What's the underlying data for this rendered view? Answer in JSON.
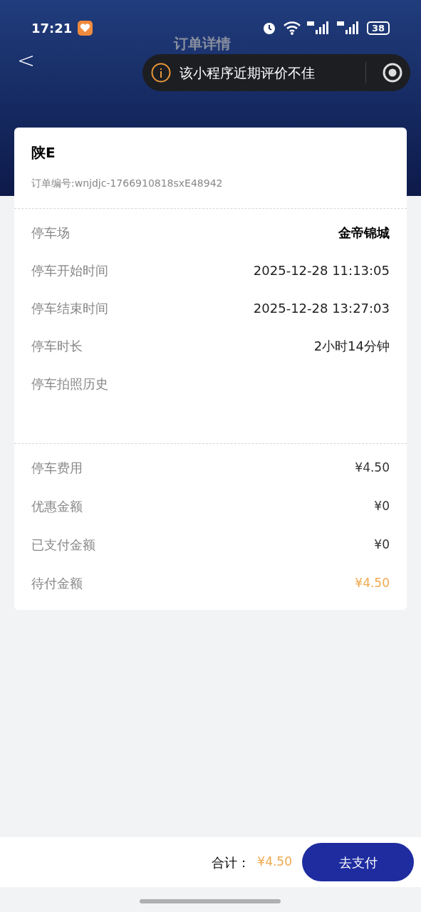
{
  "status_bar": {
    "time": "17:21",
    "battery": "38"
  },
  "nav": {
    "back": "<",
    "title": "订单详情"
  },
  "toast": {
    "text": "该小程序近期评价不佳"
  },
  "order": {
    "plate": "陕E",
    "order_no": "订单编号:wnjdjc-1766910818sxE48942"
  },
  "details": [
    {
      "label": "停车场",
      "value": "金帝锦城",
      "bold": true
    },
    {
      "label": "停车开始时间",
      "value": "2025-12-28 11:13:05",
      "bold": false
    },
    {
      "label": "停车结束时间",
      "value": "2025-12-28 13:27:03",
      "bold": false
    },
    {
      "label": "停车时长",
      "value": "2小时14分钟",
      "bold": false
    },
    {
      "label": "停车拍照历史"
    }
  ],
  "fees": [
    {
      "label": "停车费用",
      "value": "¥4.50",
      "highlight": false
    },
    {
      "label": "优惠金额",
      "value": "¥0",
      "highlight": false
    },
    {
      "label": "已支付金额",
      "value": "¥0",
      "highlight": false
    },
    {
      "label": "待付金额",
      "value": "¥4.50",
      "highlight": true
    }
  ],
  "footer": {
    "total_label": "合计：",
    "total": "¥4.50",
    "pay_button": "去支付"
  }
}
